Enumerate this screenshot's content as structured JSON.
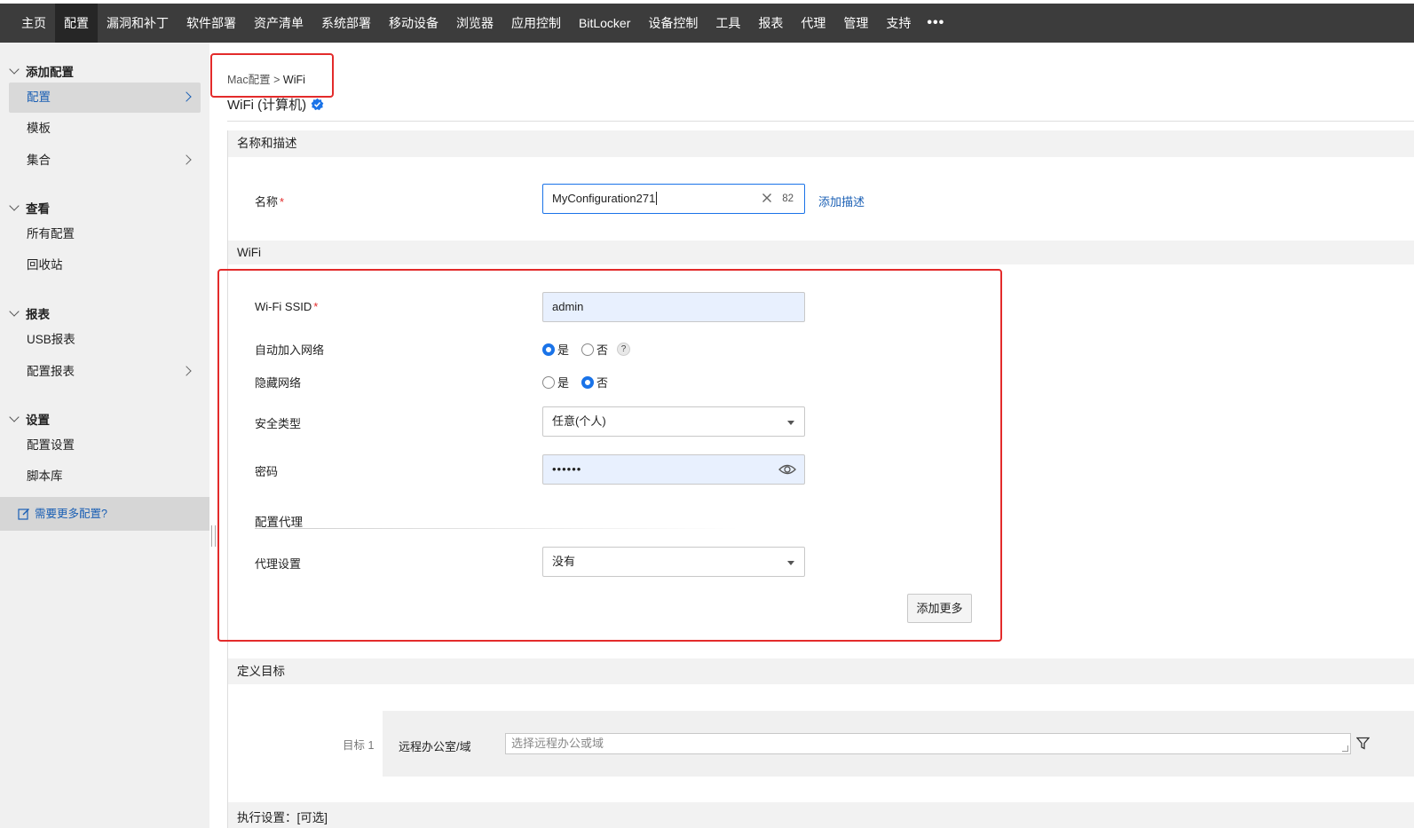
{
  "topnav": {
    "items": [
      "主页",
      "配置",
      "漏洞和补丁",
      "软件部署",
      "资产清单",
      "系统部署",
      "移动设备",
      "浏览器",
      "应用控制",
      "BitLocker",
      "设备控制",
      "工具",
      "报表",
      "代理",
      "管理",
      "支持"
    ],
    "more": "•••"
  },
  "sidebar": {
    "add_config": {
      "heading": "添加配置",
      "items": [
        "配置",
        "模板",
        "集合"
      ]
    },
    "view": {
      "heading": "查看",
      "items": [
        "所有配置",
        "回收站"
      ]
    },
    "reports": {
      "heading": "报表",
      "items": [
        "USB报表",
        "配置报表"
      ]
    },
    "settings": {
      "heading": "设置",
      "items": [
        "配置设置",
        "脚本库"
      ]
    },
    "need_more": "需要更多配置?"
  },
  "breadcrumb": {
    "parent": "Mac配置",
    "sep": ">",
    "current": "WiFi"
  },
  "page_title": "WiFi (计算机)",
  "sections": {
    "name_desc": "名称和描述",
    "wifi": "WiFi",
    "target": "定义目标",
    "exec": "执行设置：[可选]"
  },
  "name_field": {
    "label": "名称",
    "required_mark": "*",
    "value": "MyConfiguration271",
    "counter": "82",
    "add_description": "添加描述"
  },
  "wifi": {
    "ssid": {
      "label": "Wi-Fi SSID",
      "required_mark": "*",
      "value": "admin"
    },
    "auto_join": {
      "label": "自动加入网络",
      "yes": "是",
      "no": "否",
      "selected": "是",
      "help": "?"
    },
    "hidden": {
      "label": "隐藏网络",
      "yes": "是",
      "no": "否",
      "selected": "否"
    },
    "security": {
      "label": "安全类型",
      "value": "任意(个人)"
    },
    "password": {
      "label": "密码",
      "value": "••••••"
    },
    "proxy_heading": "配置代理",
    "proxy": {
      "label": "代理设置",
      "value": "没有"
    },
    "add_more": "添加更多"
  },
  "target": {
    "number": "目标 1",
    "label": "远程办公室/域",
    "placeholder": "选择远程办公或域"
  },
  "colors": {
    "topbar": "#3c3c3c",
    "accent": "#1a73e8",
    "link": "#1a5fb4",
    "highlight": "#e32b2b"
  }
}
